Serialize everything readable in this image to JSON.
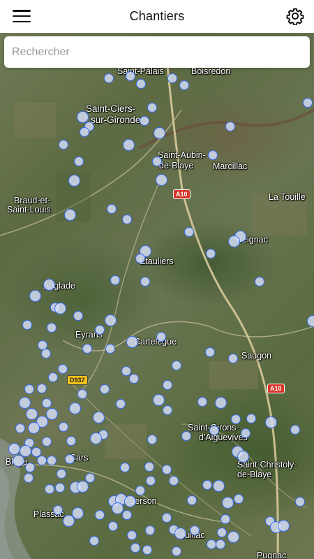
{
  "appbar": {
    "title": "Chantiers",
    "menu_icon": "menu-icon",
    "settings_icon": "gear-icon"
  },
  "search": {
    "placeholder": "Rechercher",
    "value": ""
  },
  "map": {
    "places": [
      {
        "name": "Saint-Palais"
      },
      {
        "name": "Boisredon"
      },
      {
        "name": "Saint-Ciers-"
      },
      {
        "name": "sur-Gironde"
      },
      {
        "name": "Saint-Aubin-"
      },
      {
        "name": "de-Blaye"
      },
      {
        "name": "Marcillac"
      },
      {
        "name": "La Touille"
      },
      {
        "name": "Braud-et-"
      },
      {
        "name": "Saint-Louis"
      },
      {
        "name": "Reignac"
      },
      {
        "name": "Étauliers"
      },
      {
        "name": "Anglade"
      },
      {
        "name": "Eyrans"
      },
      {
        "name": "Cartelègue"
      },
      {
        "name": "Saugon"
      },
      {
        "name": "Saint-Girons-"
      },
      {
        "name": "d'Aiguevives"
      },
      {
        "name": "Saint-Christoly-"
      },
      {
        "name": "de-Blaye"
      },
      {
        "name": "Berson"
      },
      {
        "name": "Cars"
      },
      {
        "name": "Blaye"
      },
      {
        "name": "Plassac"
      },
      {
        "name": "Teuillac"
      },
      {
        "name": "Pugnac"
      }
    ],
    "roads": [
      {
        "label": "A10"
      },
      {
        "label": "D937"
      },
      {
        "label": "A10"
      }
    ],
    "colors": {
      "marker_border": "#3a6df0",
      "water": "#8e968c"
    }
  }
}
